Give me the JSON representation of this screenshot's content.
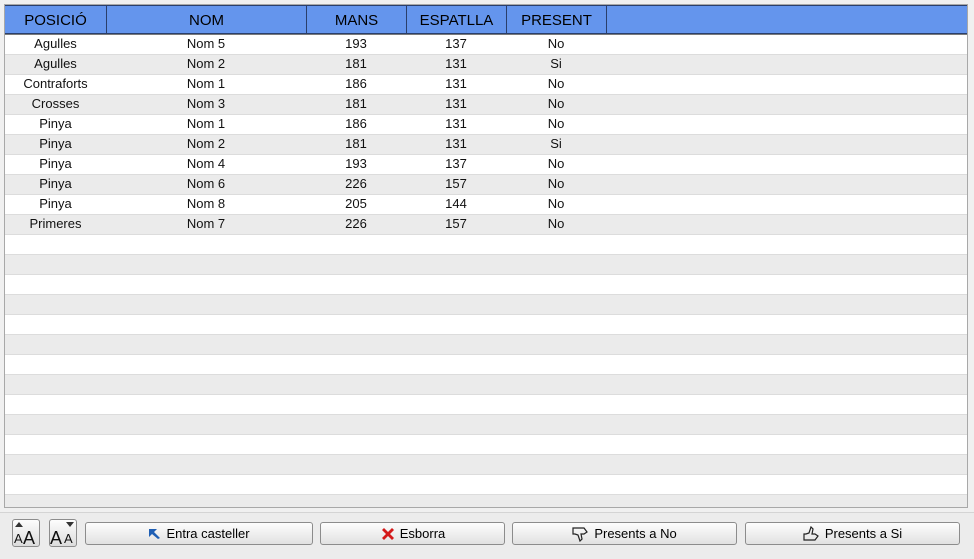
{
  "table": {
    "columns": [
      "POSICIÓ",
      "NOM",
      "MANS",
      "ESPATLLA",
      "PRESENT"
    ],
    "rows": [
      [
        "Agulles",
        "Nom 5",
        "193",
        "137",
        "No"
      ],
      [
        "Agulles",
        "Nom 2",
        "181",
        "131",
        "Si"
      ],
      [
        "Contraforts",
        "Nom 1",
        "186",
        "131",
        "No"
      ],
      [
        "Crosses",
        "Nom 3",
        "181",
        "131",
        "No"
      ],
      [
        "Pinya",
        "Nom 1",
        "186",
        "131",
        "No"
      ],
      [
        "Pinya",
        "Nom 2",
        "181",
        "131",
        "Si"
      ],
      [
        "Pinya",
        "Nom 4",
        "193",
        "137",
        "No"
      ],
      [
        "Pinya",
        "Nom 6",
        "226",
        "157",
        "No"
      ],
      [
        "Pinya",
        "Nom 8",
        "205",
        "144",
        "No"
      ],
      [
        "Primeres",
        "Nom 7",
        "226",
        "157",
        "No"
      ]
    ],
    "empty_rows": 14,
    "header_color": "#6495ed"
  },
  "toolbar": {
    "increase_font_icon": "font-increase-icon",
    "decrease_font_icon": "font-decrease-icon",
    "entra_label": "Entra casteller",
    "entra_icon": "arrow-up-left-icon",
    "esborra_label": "Esborra",
    "esborra_icon": "red-x-icon",
    "presents_no_label": "Presents a No",
    "presents_no_icon": "thumbs-down-icon",
    "presents_si_label": "Presents a Si",
    "presents_si_icon": "thumbs-up-icon"
  }
}
